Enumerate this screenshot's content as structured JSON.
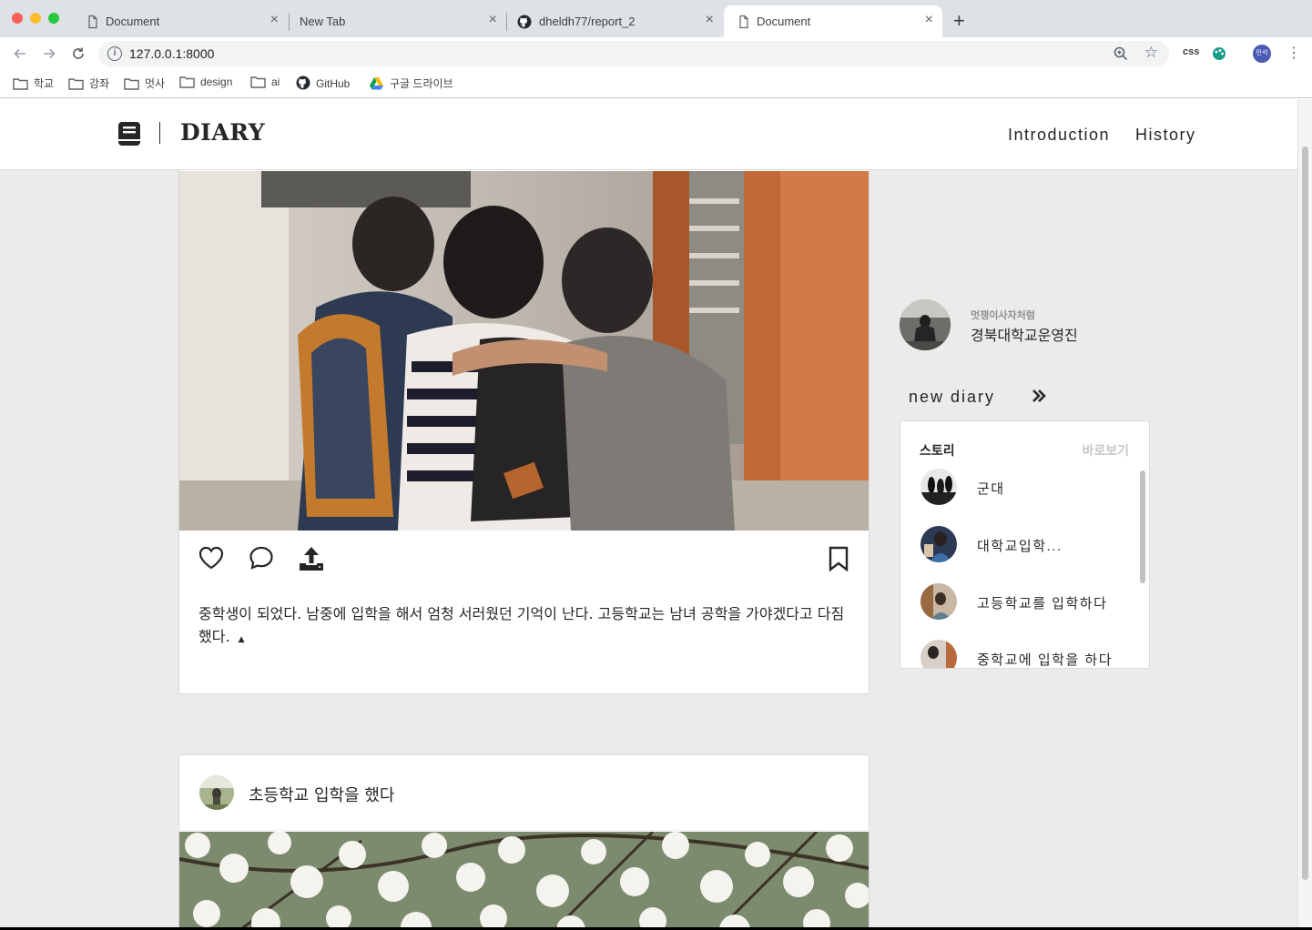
{
  "browser": {
    "tabs": [
      {
        "title": "Document"
      },
      {
        "title": "New Tab"
      },
      {
        "title": "dheldh77/report_2"
      },
      {
        "title": "Document"
      }
    ],
    "close_glyph": "×",
    "new_tab_glyph": "+",
    "url": "127.0.0.1:8000",
    "info_glyph": "i",
    "star_glyph": "☆",
    "extensions": {
      "css": "css"
    },
    "profile_initials": "민석",
    "menu_glyph": "⋮",
    "bookmarks": [
      {
        "label": "학교",
        "icon": "folder-icon"
      },
      {
        "label": "강좌",
        "icon": "folder-icon"
      },
      {
        "label": "멋사",
        "icon": "folder-icon"
      },
      {
        "label": "design",
        "icon": "folder-icon"
      },
      {
        "label": "ai",
        "icon": "folder-icon"
      },
      {
        "label": "GitHub",
        "icon": "github-icon"
      },
      {
        "label": "구글 드라이브",
        "icon": "google-drive-icon"
      }
    ]
  },
  "header": {
    "logo_text": "DIARY",
    "nav": [
      "Introduction",
      "History"
    ]
  },
  "post1": {
    "caption": "중학생이 되었다. 남중에 입학을 해서 엄청 서러웠던 기억이 난다. 고등학교는 남녀 공학을 가야겠다고 다짐했다.",
    "caption_toggle": "▲"
  },
  "post2": {
    "title": "초등학교 입학을 했다"
  },
  "profile": {
    "subtitle": "멋쟁이사자처럼",
    "name": "경북대학교운영진"
  },
  "new_diary": {
    "label": "new diary",
    "chevron_glyph": "»"
  },
  "stories": {
    "title": "스토리",
    "see_all": "바로보기",
    "items": [
      {
        "label": "군대"
      },
      {
        "label": "대학교입학..."
      },
      {
        "label": "고등학교를 입학하다"
      },
      {
        "label": "중학교에 입학을 하다"
      }
    ]
  },
  "colors": {
    "accent_text": "#262626",
    "page_bg": "#ebebeb",
    "tab_strip": "#dee1e6"
  }
}
